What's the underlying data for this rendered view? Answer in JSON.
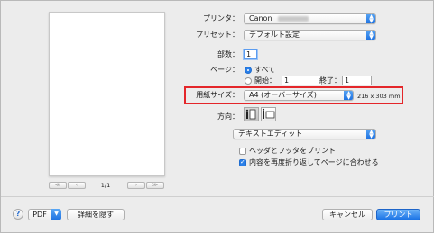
{
  "printer": {
    "label": "プリンタ：",
    "value": "Canon"
  },
  "preset": {
    "label": "プリセット：",
    "value": "デフォルト設定"
  },
  "copies": {
    "label": "部数：",
    "value": "1"
  },
  "pages": {
    "label": "ページ：",
    "all_label": "すべて",
    "from_label": "開始：",
    "from_value": "1",
    "to_label": "終了：",
    "to_value": "1",
    "selected": "all"
  },
  "paper_size": {
    "label": "用紙サイズ：",
    "value": "A4 (オーバーサイズ)",
    "dimensions": "216 x 303 mm"
  },
  "orientation": {
    "label": "方向：",
    "selected": "portrait"
  },
  "app_section": {
    "value": "テキストエディット"
  },
  "options": {
    "header_footer": {
      "label": "ヘッダとフッタをプリント",
      "checked": false
    },
    "rewrap": {
      "label": "内容を再度折り返してページに合わせる",
      "checked": true
    }
  },
  "preview": {
    "page_indicator": "1/1",
    "first_icon": "≪",
    "prev_icon": "‹",
    "next_icon": "›",
    "last_icon": "≫"
  },
  "footer": {
    "help_icon": "?",
    "pdf_label": "PDF",
    "hide_details_label": "詳細を隠す",
    "cancel_label": "キャンセル",
    "print_label": "プリント"
  },
  "colors": {
    "accent": "#1a73e6",
    "highlight": "#e4262a"
  }
}
